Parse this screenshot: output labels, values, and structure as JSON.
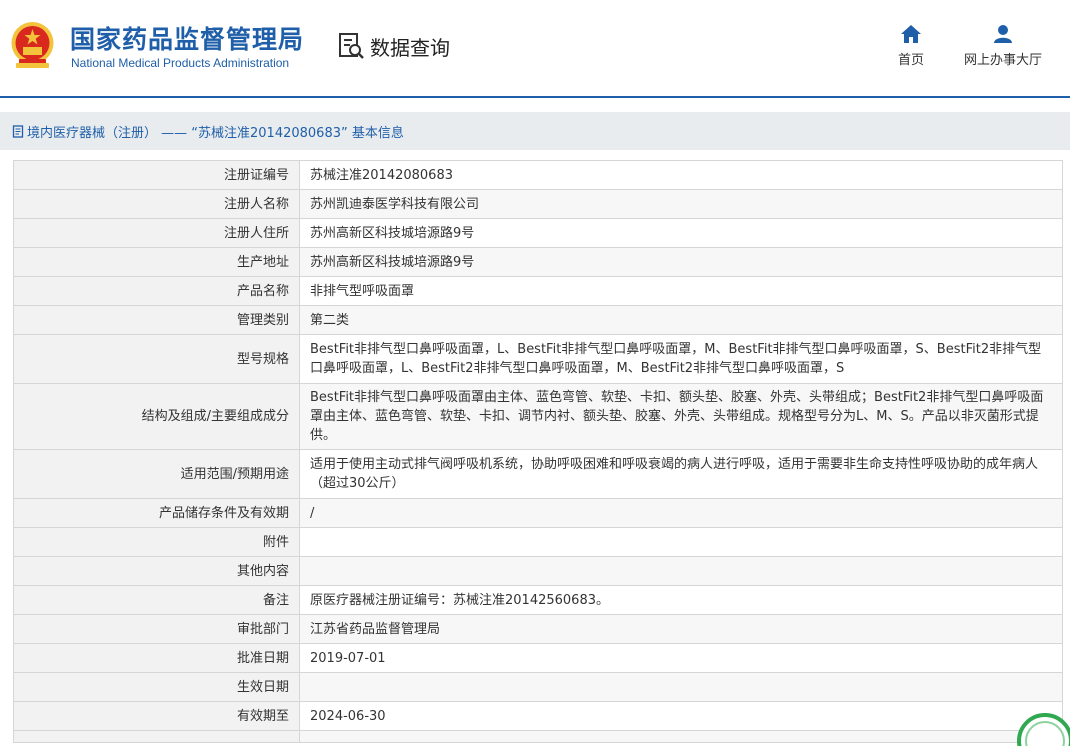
{
  "header": {
    "brand_cn": "国家药品监督管理局",
    "brand_en": "National Medical Products Administration",
    "query_label": "数据查询",
    "nav": [
      {
        "label": "首页",
        "icon": "home-icon"
      },
      {
        "label": "网上办事大厅",
        "icon": "user-icon"
      }
    ]
  },
  "breadcrumb": {
    "text": "境内医疗器械（注册） —— “苏械注准20142080683” 基本信息"
  },
  "details": [
    {
      "key": "注册证编号",
      "value": "苏械注准20142080683"
    },
    {
      "key": "注册人名称",
      "value": "苏州凯迪泰医学科技有限公司"
    },
    {
      "key": "注册人住所",
      "value": "苏州高新区科技城培源路9号"
    },
    {
      "key": "生产地址",
      "value": "苏州高新区科技城培源路9号"
    },
    {
      "key": "产品名称",
      "value": "非排气型呼吸面罩"
    },
    {
      "key": "管理类别",
      "value": "第二类"
    },
    {
      "key": "型号规格",
      "value": "BestFit非排气型口鼻呼吸面罩，L、BestFit非排气型口鼻呼吸面罩，M、BestFit非排气型口鼻呼吸面罩，S、BestFit2非排气型口鼻呼吸面罩，L、BestFit2非排气型口鼻呼吸面罩，M、BestFit2非排气型口鼻呼吸面罩，S"
    },
    {
      "key": "结构及组成/主要组成成分",
      "value": "BestFit非排气型口鼻呼吸面罩由主体、蓝色弯管、软垫、卡扣、额头垫、胶塞、外壳、头带组成；BestFit2非排气型口鼻呼吸面罩由主体、蓝色弯管、软垫、卡扣、调节内衬、额头垫、胶塞、外壳、头带组成。规格型号分为L、M、S。产品以非灭菌形式提供。"
    },
    {
      "key": "适用范围/预期用途",
      "value": "适用于使用主动式排气阀呼吸机系统，协助呼吸困难和呼吸衰竭的病人进行呼吸，适用于需要非生命支持性呼吸协助的成年病人（超过30公斤）"
    },
    {
      "key": "产品储存条件及有效期",
      "value": "/"
    },
    {
      "key": "附件",
      "value": ""
    },
    {
      "key": "其他内容",
      "value": ""
    },
    {
      "key": "备注",
      "value": "原医疗器械注册证编号：苏械注准20142560683。"
    },
    {
      "key": "审批部门",
      "value": "江苏省药品监督管理局"
    },
    {
      "key": "批准日期",
      "value": "2019-07-01"
    },
    {
      "key": "生效日期",
      "value": ""
    },
    {
      "key": "有效期至",
      "value": "2024-06-30"
    }
  ],
  "colors": {
    "brand_blue": "#1f5fa9",
    "emblem_red": "#d9281e",
    "emblem_gold": "#f3c33b",
    "crumb_bg": "#e9ecef",
    "label_bg": "#f2f2f2"
  }
}
